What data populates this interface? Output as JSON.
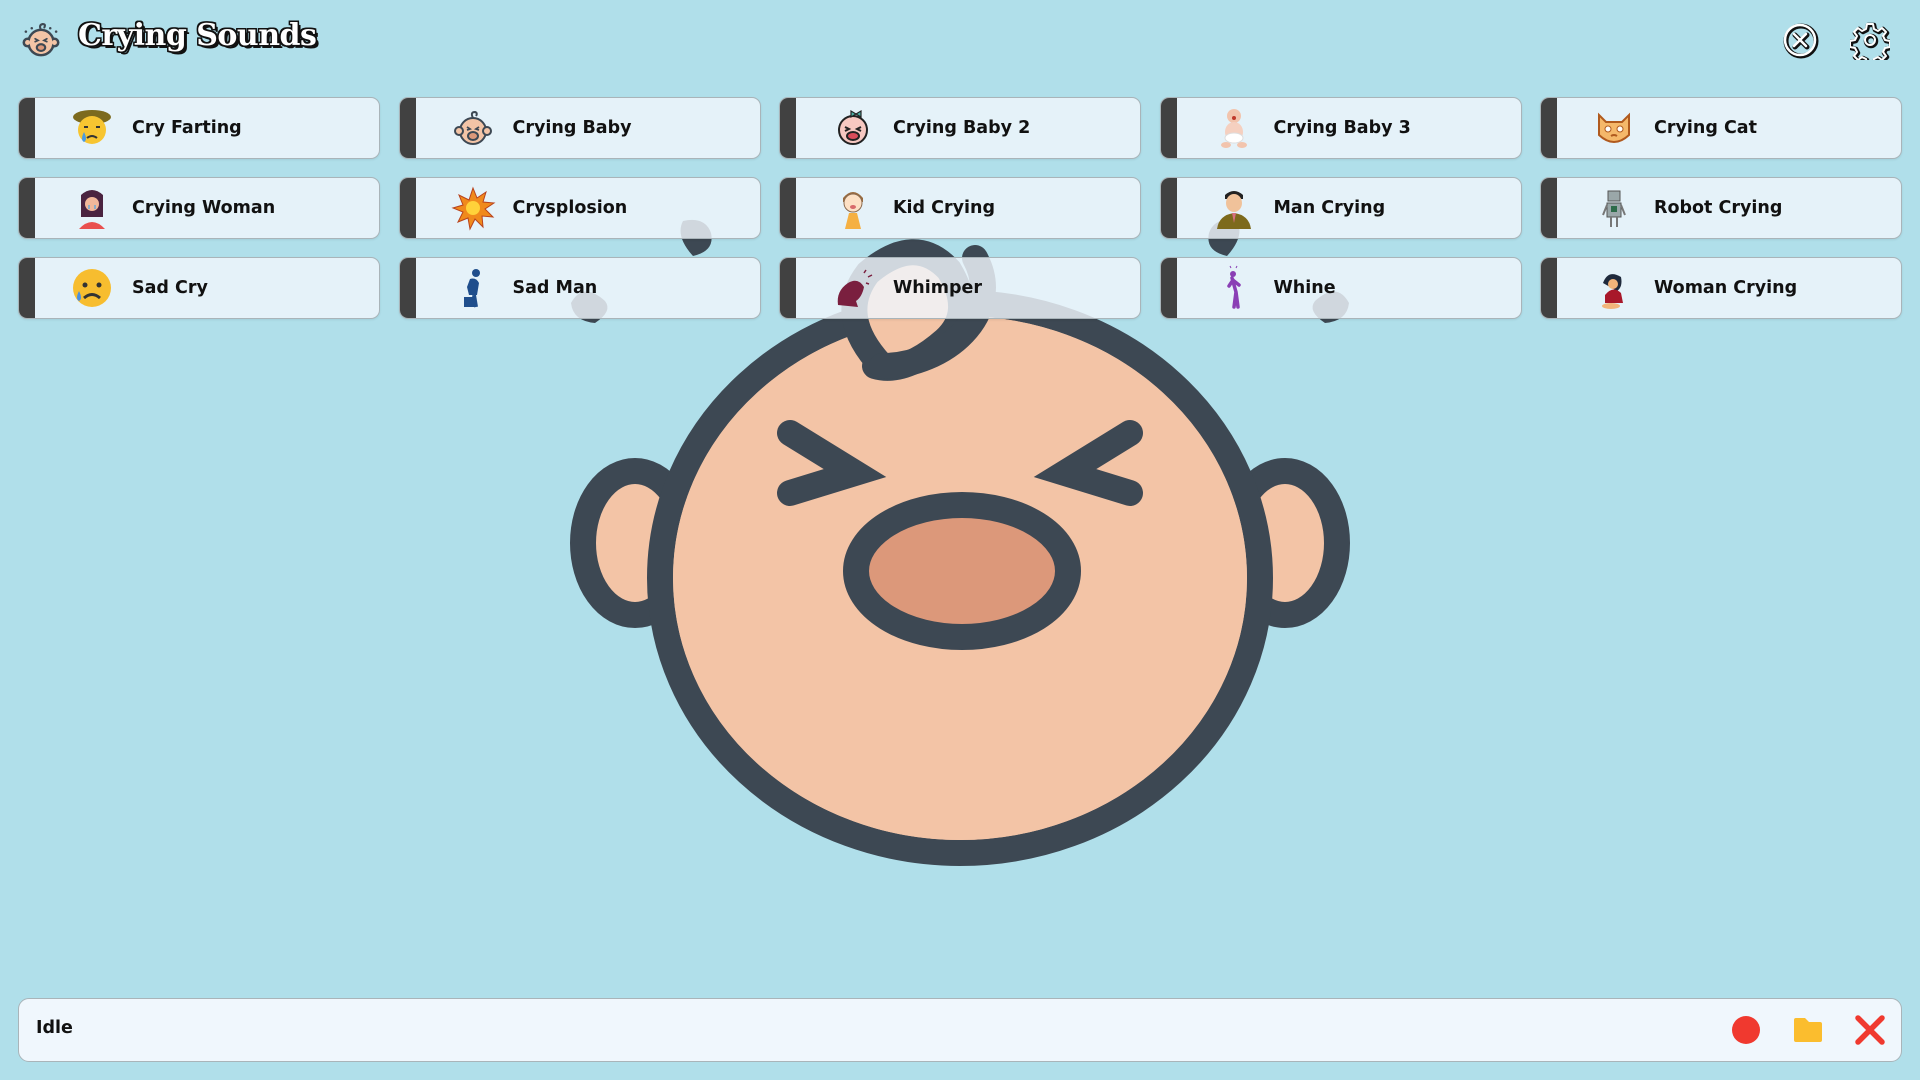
{
  "app": {
    "title": "Crying Sounds",
    "logo_icon": "crying-baby-face-icon"
  },
  "header": {
    "close_icon": "circle-x-icon",
    "settings_icon": "gear-icon"
  },
  "sounds": [
    {
      "label": "Cry Farting",
      "icon": "crying-face-hat-icon"
    },
    {
      "label": "Crying Baby",
      "icon": "crying-baby-face-icon"
    },
    {
      "label": "Crying Baby 2",
      "icon": "crying-baby-girl-icon"
    },
    {
      "label": "Crying Baby 3",
      "icon": "sitting-baby-icon"
    },
    {
      "label": "Crying Cat",
      "icon": "crying-cat-icon"
    },
    {
      "label": "Crying Woman",
      "icon": "crying-woman-icon"
    },
    {
      "label": "Crysplosion",
      "icon": "explosion-icon"
    },
    {
      "label": "Kid Crying",
      "icon": "crying-kid-icon"
    },
    {
      "label": "Man Crying",
      "icon": "crying-man-icon"
    },
    {
      "label": "Robot Crying",
      "icon": "robot-icon"
    },
    {
      "label": "Sad Cry",
      "icon": "sad-tear-emoji-icon"
    },
    {
      "label": "Sad Man",
      "icon": "sad-man-sitting-icon"
    },
    {
      "label": "Whimper",
      "icon": "whimper-figure-icon"
    },
    {
      "label": "Whine",
      "icon": "whine-figure-icon"
    },
    {
      "label": "Woman Crying",
      "icon": "woman-kneeling-crying-icon"
    }
  ],
  "background": {
    "icon": "crying-baby-face-icon"
  },
  "status": {
    "text": "Idle",
    "record_icon": "record-icon",
    "folder_icon": "folder-icon",
    "stop_icon": "x-icon"
  },
  "colors": {
    "background": "#b0dfea",
    "button_bar": "#414141",
    "record": "#f0392f",
    "folder": "#fbbd2e",
    "stop": "#f0392f",
    "baby_outline": "#3d4853",
    "baby_skin": "#f3c4a6",
    "baby_mouth": "#dc987a"
  }
}
